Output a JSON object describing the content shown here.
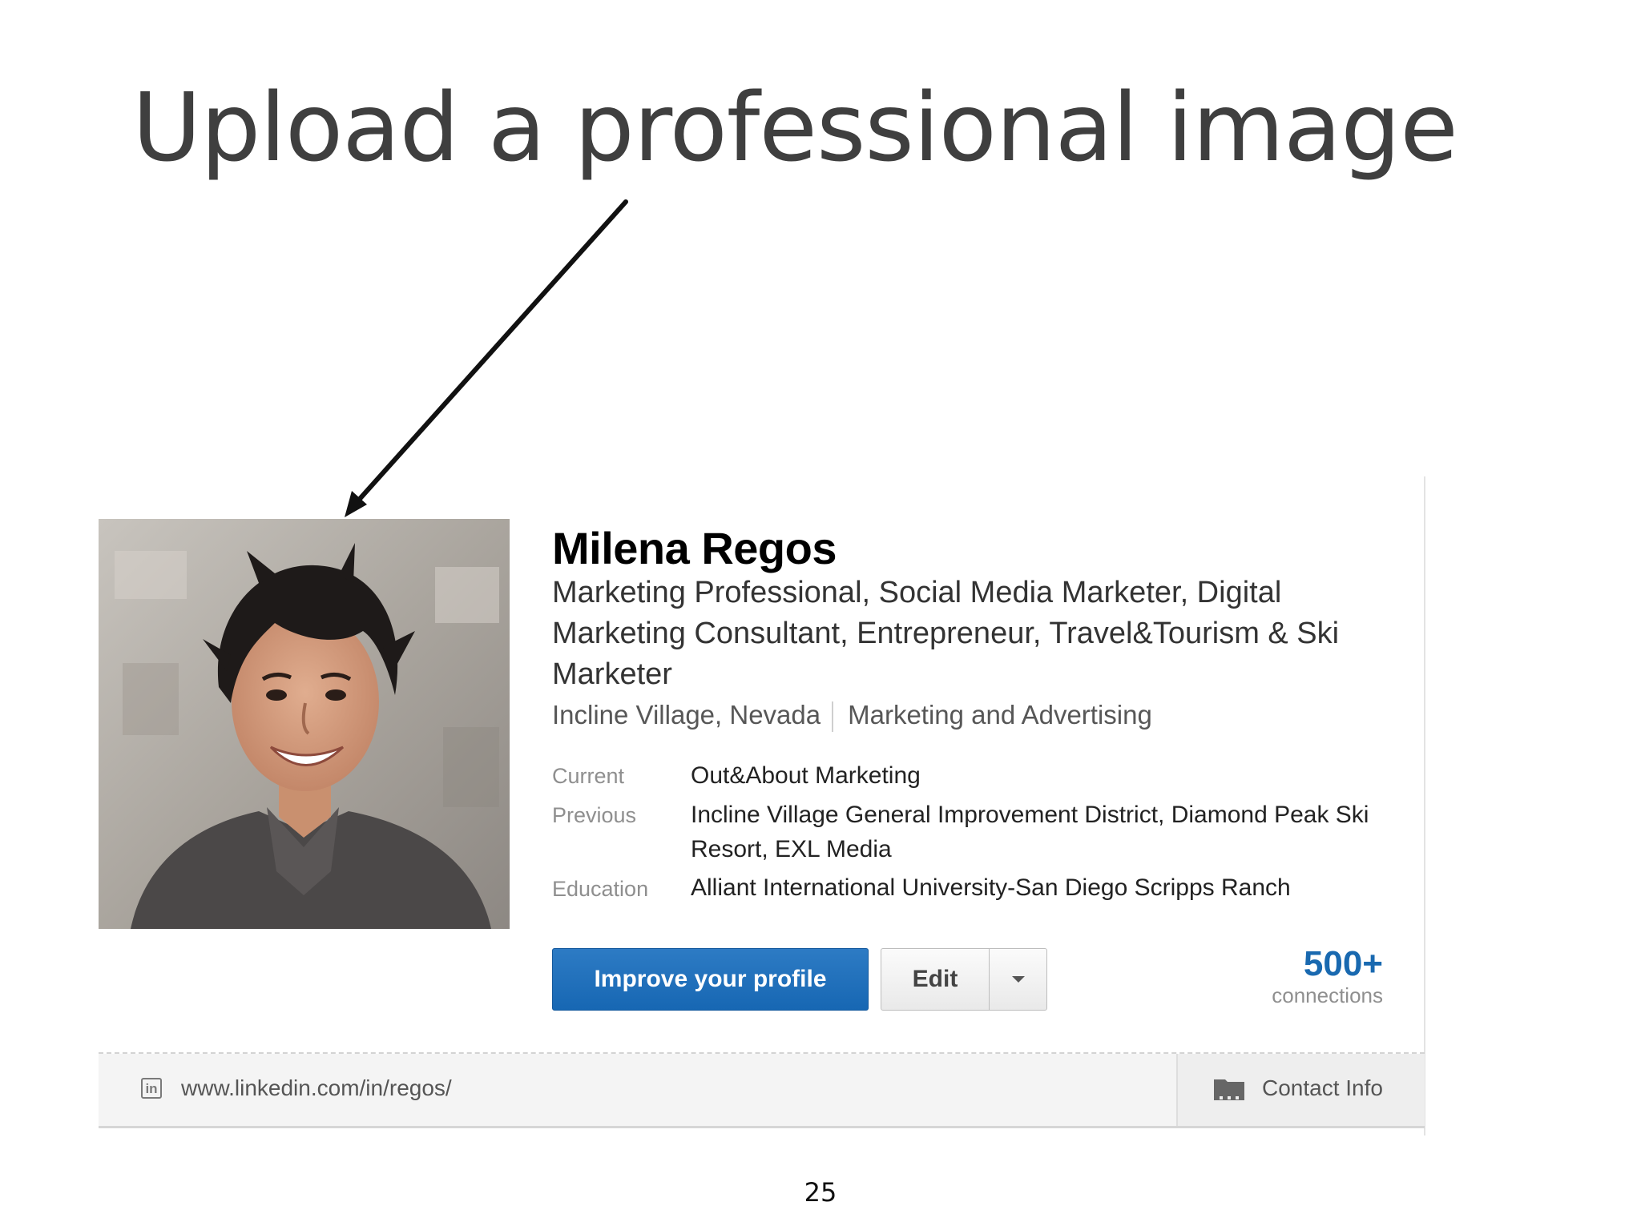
{
  "slide": {
    "title": "Upload a professional image",
    "page_number": "25"
  },
  "profile": {
    "name": "Milena Regos",
    "headline": "Marketing Professional, Social Media Marketer, Digital Marketing Consultant, Entrepreneur, Travel&Tourism & Ski Marketer",
    "location": "Incline Village, Nevada",
    "industry": "Marketing and Advertising",
    "details": [
      {
        "label": "Current",
        "value": "Out&About Marketing"
      },
      {
        "label": "Previous",
        "value": "Incline Village General Improvement District, Diamond Peak Ski Resort, EXL Media"
      },
      {
        "label": "Education",
        "value": "Alliant International University-San Diego Scripps Ranch"
      }
    ],
    "buttons": {
      "improve": "Improve your profile",
      "edit": "Edit"
    },
    "connections": {
      "count": "500+",
      "label": "connections"
    },
    "footer": {
      "url": "www.linkedin.com/in/regos/",
      "contact_label": "Contact Info"
    }
  },
  "icons": {
    "linkedin_icon_text": "in",
    "dropdown": "caret-down-icon",
    "contact": "address-book-icon"
  },
  "colors": {
    "primary_button": "#1767b3",
    "connections": "#1969b0",
    "title": "#3f3f3f"
  }
}
